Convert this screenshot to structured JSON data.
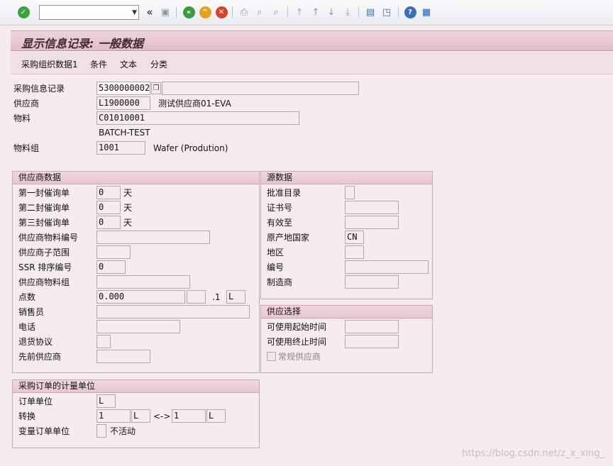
{
  "toolbar": {
    "command_field": "",
    "icons": [
      "enter-icon",
      "back-double-icon",
      "save-icon",
      "back-icon",
      "exit-icon",
      "cancel-icon",
      "print-icon",
      "find-icon",
      "find-next-icon",
      "first-page-icon",
      "previous-page-icon",
      "next-page-icon",
      "last-page-icon",
      "create-session-icon",
      "shortcut-icon",
      "help-icon",
      "customize-layout-icon"
    ]
  },
  "title": "显示信息记录: 一般数据",
  "menu": [
    "采购组织数据1",
    "条件",
    "文本",
    "分类"
  ],
  "header": {
    "info_record_label": "采购信息记录",
    "info_record_value": "5300000002",
    "vendor_label": "供应商",
    "vendor_value": "L1900000",
    "vendor_name": "测试供应商01-EVA",
    "material_label": "物料",
    "material_value": "C01010001",
    "material_desc": "BATCH-TEST",
    "material_group_label": "物料组",
    "material_group_value": "1001",
    "material_group_desc": "Wafer (Prodution)"
  },
  "vendor_data": {
    "title": "供应商数据",
    "reminder1_label": "第一封催询单",
    "reminder1_value": "0",
    "reminder2_label": "第二封催询单",
    "reminder2_value": "0",
    "reminder3_label": "第三封催询单",
    "reminder3_value": "0",
    "day_unit": "天",
    "vendor_material_no_label": "供应商物料编号",
    "vendor_subrange_label": "供应商子范围",
    "ssr_label": "SSR 排序编号",
    "ssr_value": "0",
    "vendor_material_group_label": "供应商物料组",
    "points_label": "点数",
    "points_value": "0.000",
    "points_per": ".1",
    "points_unit": "L",
    "salesperson_label": "销售员",
    "phone_label": "电话",
    "return_agreement_label": "退货协议",
    "prior_vendor_label": "先前供应商"
  },
  "source_data": {
    "title": "源数据",
    "approved_catalog_label": "批准目录",
    "certificate_label": "证书号",
    "valid_to_label": "有效至",
    "country_label": "原产地国家",
    "country_value": "CN",
    "region_label": "地区",
    "number_label": "编号",
    "manufacturer_label": "制造商"
  },
  "supply_option": {
    "title": "供应选择",
    "available_from_label": "可使用起始时间",
    "available_to_label": "可使用终止时间",
    "regular_vendor_label": "常规供应商"
  },
  "po_unit": {
    "title": "采购订单的计量单位",
    "order_unit_label": "订单单位",
    "order_unit_value": "L",
    "conversion_label": "转换",
    "conv_left_value": "1",
    "conv_left_unit": "L",
    "conv_arrow": "<->",
    "conv_right_value": "1",
    "conv_right_unit": "L",
    "variable_unit_label": "变量订单单位",
    "variable_unit_status": "不活动"
  },
  "watermark": "https://blog.csdn.net/z_x_xing_"
}
